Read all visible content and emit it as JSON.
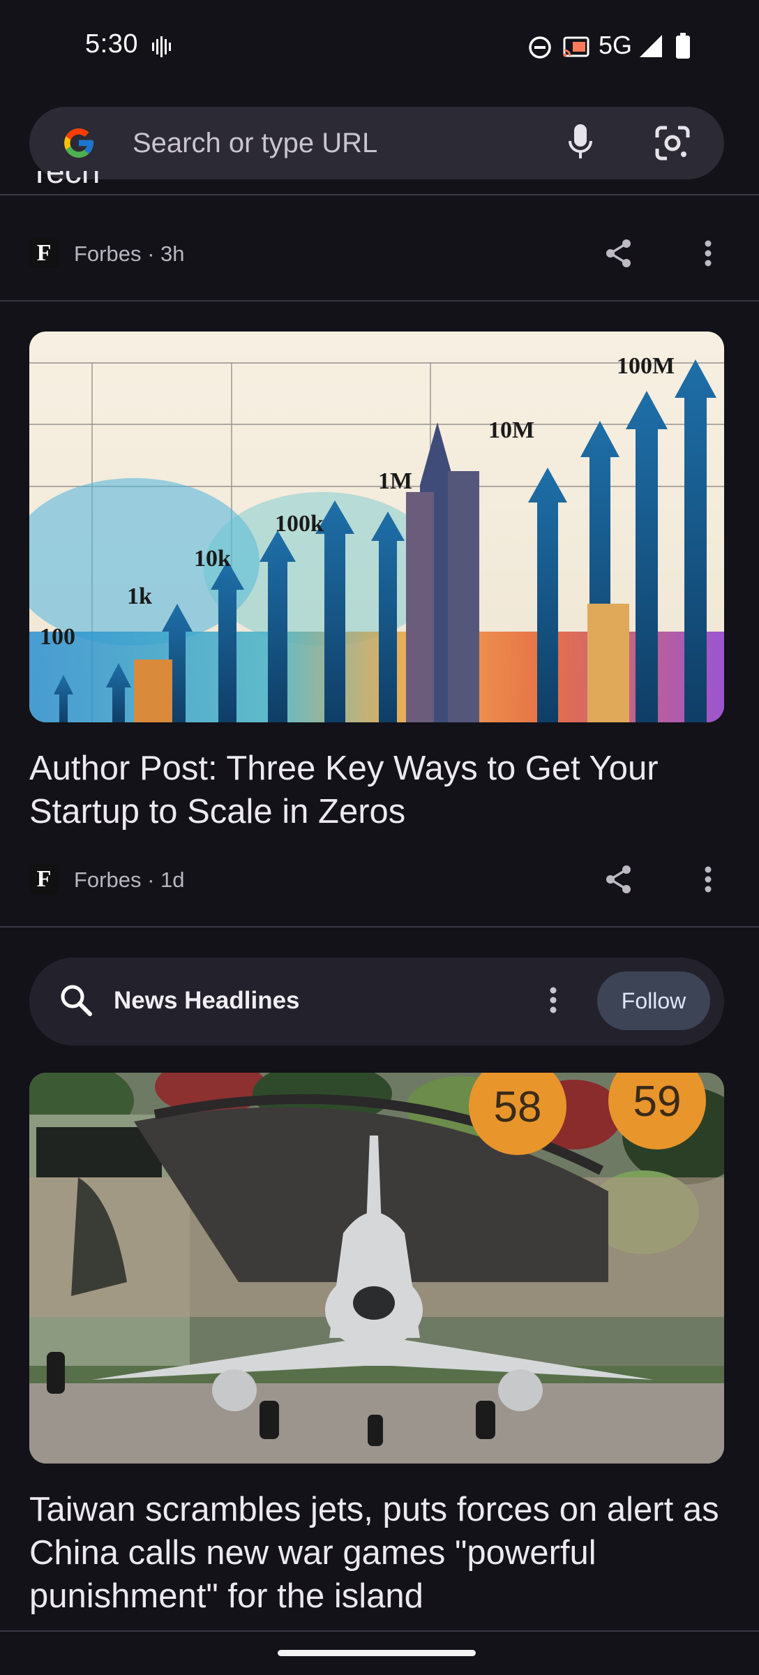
{
  "status_bar": {
    "time": "5:30",
    "network": "5G",
    "icons": [
      "vibrate-icon",
      "do-not-disturb-icon",
      "cast-icon",
      "signal-icon",
      "battery-icon"
    ]
  },
  "search": {
    "placeholder": "Search or type URL",
    "icons": [
      "google-logo",
      "mic-icon",
      "lens-icon"
    ]
  },
  "feed": {
    "clipped_title": "Tech",
    "item1": {
      "source": "Forbes · 3h"
    },
    "item2": {
      "chart_labels": [
        "100",
        "1k",
        "10k",
        "100k",
        "1M",
        "10M",
        "100M"
      ],
      "title": "Author Post: Three Key Ways to Get Your Startup to Scale in Zeros",
      "source": "Forbes · 1d"
    },
    "topic": {
      "title": "News Headlines",
      "follow_label": "Follow"
    },
    "item3": {
      "badges": [
        "58",
        "59"
      ],
      "title": "Taiwan scrambles jets, puts forces on alert as China calls new war games \"powerful punishment\" for the island"
    }
  },
  "colors": {
    "background": "#121218",
    "search_bg": "#2b2a35",
    "follow_bg": "#3d4456",
    "badge_orange": "#e8952c"
  }
}
